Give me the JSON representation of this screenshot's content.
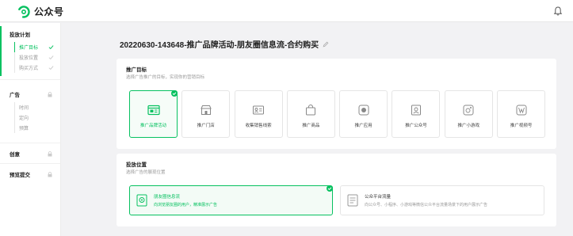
{
  "header": {
    "app_name": "公众号"
  },
  "sidebar": {
    "groups": [
      {
        "title": "投放计划",
        "items": [
          "推广目标",
          "投放位置",
          "购买方式"
        ]
      },
      {
        "title": "广告",
        "items": [
          "时间",
          "定向",
          "预算"
        ]
      },
      {
        "title": "创意"
      },
      {
        "title": "预览提交"
      }
    ]
  },
  "main": {
    "page_title": "20220630-143648-推广品牌活动-朋友圈信息流-合约购买",
    "goal_section": {
      "title": "推广目标",
      "subtitle": "选择广告推广的目标，实现你的营销目标",
      "options": [
        {
          "label": "推广品牌活动",
          "icon": "web-page-icon"
        },
        {
          "label": "推广门店",
          "icon": "store-icon"
        },
        {
          "label": "收集销售线索",
          "icon": "contact-card-icon"
        },
        {
          "label": "推广商品",
          "icon": "shopping-bag-icon"
        },
        {
          "label": "推广应用",
          "icon": "app-icon"
        },
        {
          "label": "推广公众号",
          "icon": "official-account-icon"
        },
        {
          "label": "推广小游戏",
          "icon": "mini-game-icon"
        },
        {
          "label": "推广视频号",
          "icon": "channels-icon"
        }
      ],
      "selected_index": 0
    },
    "placement_section": {
      "title": "投放位置",
      "subtitle": "选择广告的展现位置",
      "options": [
        {
          "name": "朋友圈信息流",
          "desc": "向浏览朋友圈的用户，精准展示广告"
        },
        {
          "name": "公众平台流量",
          "desc": "向公众号、小程序、小游戏等微信公众平台流量场景下的用户展示广告"
        }
      ],
      "selected_index": 0
    }
  },
  "colors": {
    "accent": "#07c160",
    "background": "#f2f2f4"
  }
}
